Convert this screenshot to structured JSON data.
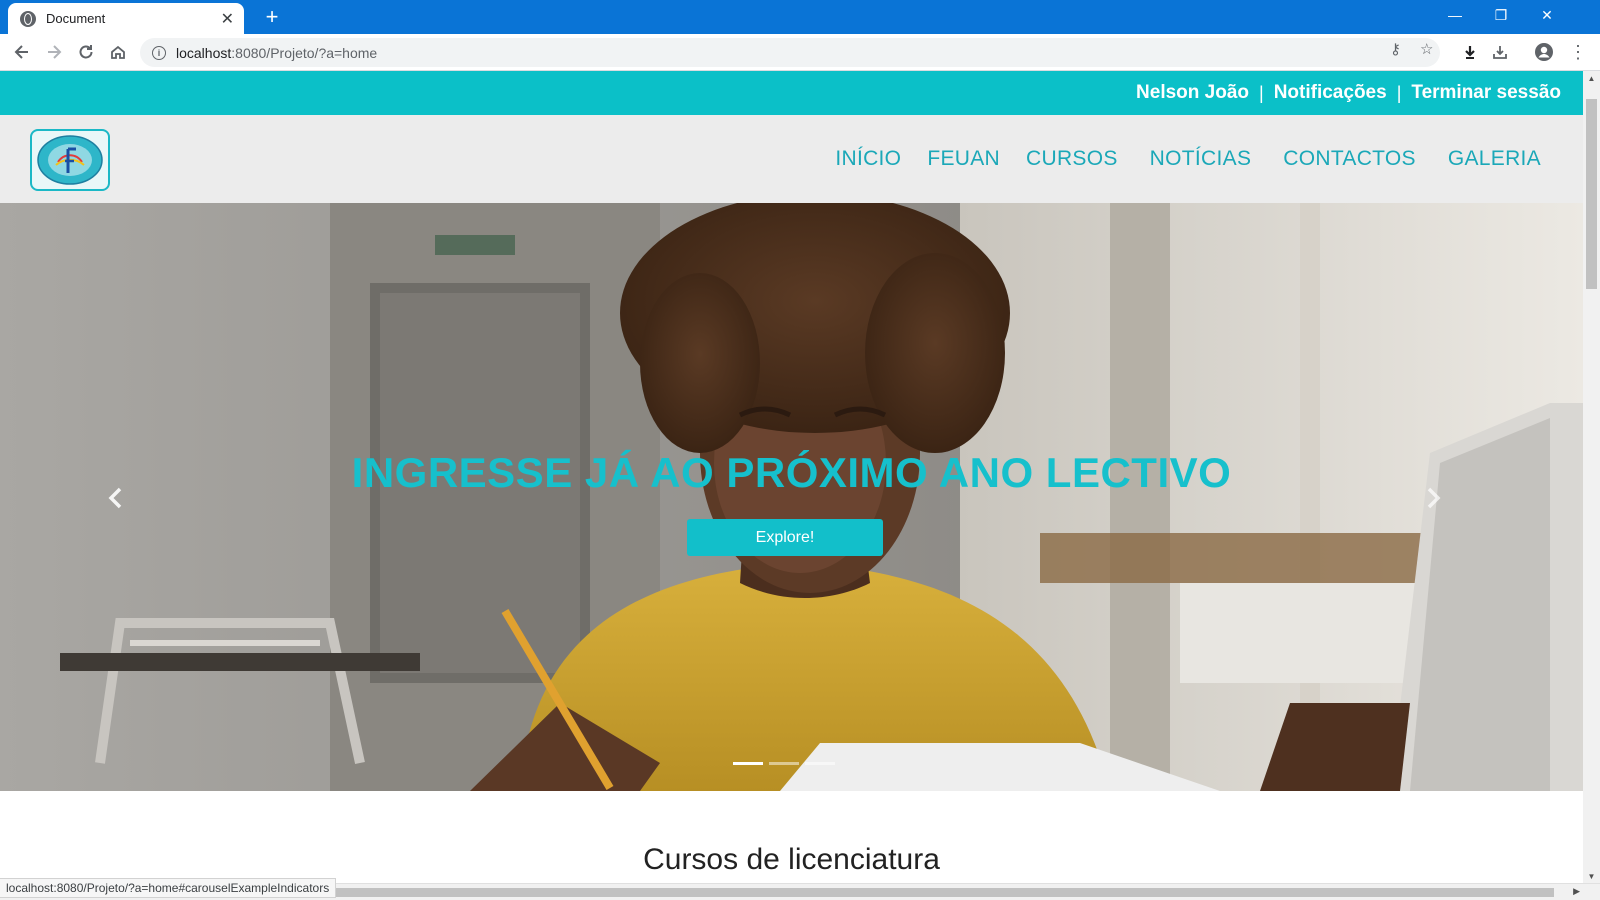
{
  "browser": {
    "tab_title": "Document",
    "url_host": "localhost",
    "url_rest": ":8080/Projeto/?a=home"
  },
  "site": {
    "topbar": {
      "user": "Nelson João",
      "sep": "|",
      "notifications": "Notificações",
      "logout": "Terminar sessão"
    },
    "nav": [
      "INÍCIO",
      "FEUAN",
      "CURSOS",
      "NOTÍCIAS",
      "CONTACTOS",
      "GALERIA"
    ],
    "hero": {
      "title": "INGRESSE JÁ AO PRÓXIMO ANO LECTIVO",
      "button": "Explore!",
      "active_slide": 1,
      "slides": 3
    },
    "section_title": "Cursos de licenciatura"
  },
  "status_bar": "localhost:8080/Projeto/?a=home#carouselExampleIndicators",
  "colors": {
    "accent": "#0bc0c8",
    "nav_text": "#1ba8b8",
    "chrome_blue": "#0a74d6"
  }
}
